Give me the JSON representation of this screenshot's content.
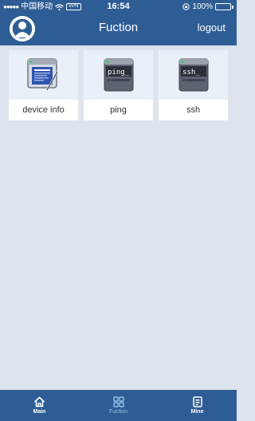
{
  "status_bar": {
    "carrier": "中国移动",
    "vpn": "VPN",
    "time": "16:54",
    "battery": "100%",
    "battery_color": "#4cd964"
  },
  "header": {
    "title": "Fuction",
    "logout_label": "logout",
    "bg_color": "#2e5d95"
  },
  "functions": [
    {
      "label": "device info",
      "icon": "device-info-icon"
    },
    {
      "label": "ping",
      "icon": "ping-terminal-icon",
      "icon_text": "ping_"
    },
    {
      "label": "ssh",
      "icon": "ssh-terminal-icon",
      "icon_text": "ssh_"
    }
  ],
  "tabbar": {
    "tabs": [
      {
        "label": "Main",
        "icon": "home-icon",
        "active": false
      },
      {
        "label": "Fuction",
        "icon": "function-grid-icon",
        "active": true
      },
      {
        "label": "Mine",
        "icon": "mine-icon",
        "active": false
      }
    ],
    "active_color": "#8fc6e8"
  }
}
